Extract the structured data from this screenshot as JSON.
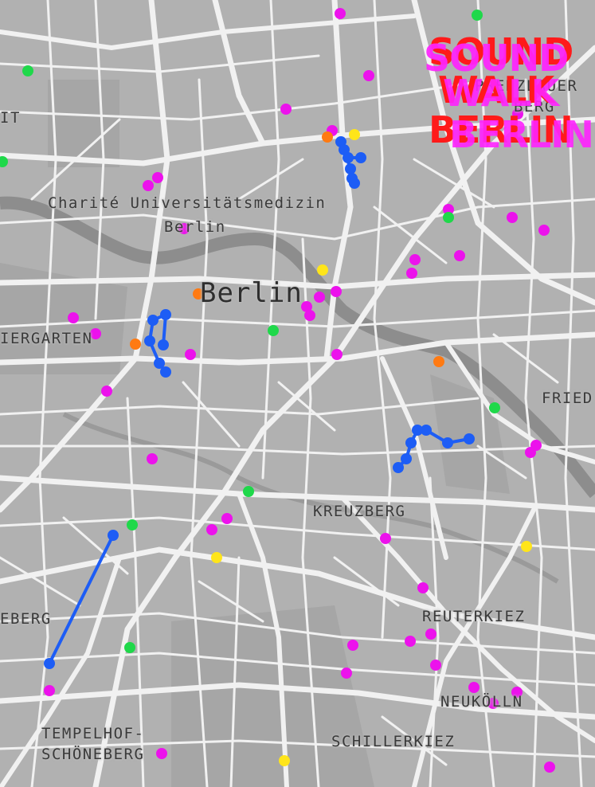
{
  "map": {
    "city_label": "Berlin",
    "district_labels": [
      "Charité Universitätsmedizin",
      "Berlin",
      "KREUZBERG",
      "REUTERKIEZ",
      "NEUKÖLLN",
      "SCHILLERKIEZ",
      "TEMPELHOF-",
      "SCHÖNEBERG",
      "IERGARTEN",
      "EBERG",
      "IT",
      "FRIED",
      "PRENZLAUER",
      "BERG"
    ],
    "colors": {
      "background": "#b1b1b1",
      "roads": "#f2f2f2",
      "blocks": "#bcbcbc",
      "parks": "#a5a5a5",
      "river": "#8e8e8e",
      "route": "#1d5df5",
      "magenta_marker": "#ec12ec",
      "green_marker": "#1fd84a",
      "orange_marker": "#ff7a12",
      "yellow_marker": "#ffe51a"
    }
  },
  "logo": {
    "lines": [
      "SOUND",
      "WALK",
      "BERLIN"
    ],
    "colors": [
      "#ff1a1a",
      "#ff23ff"
    ]
  }
}
